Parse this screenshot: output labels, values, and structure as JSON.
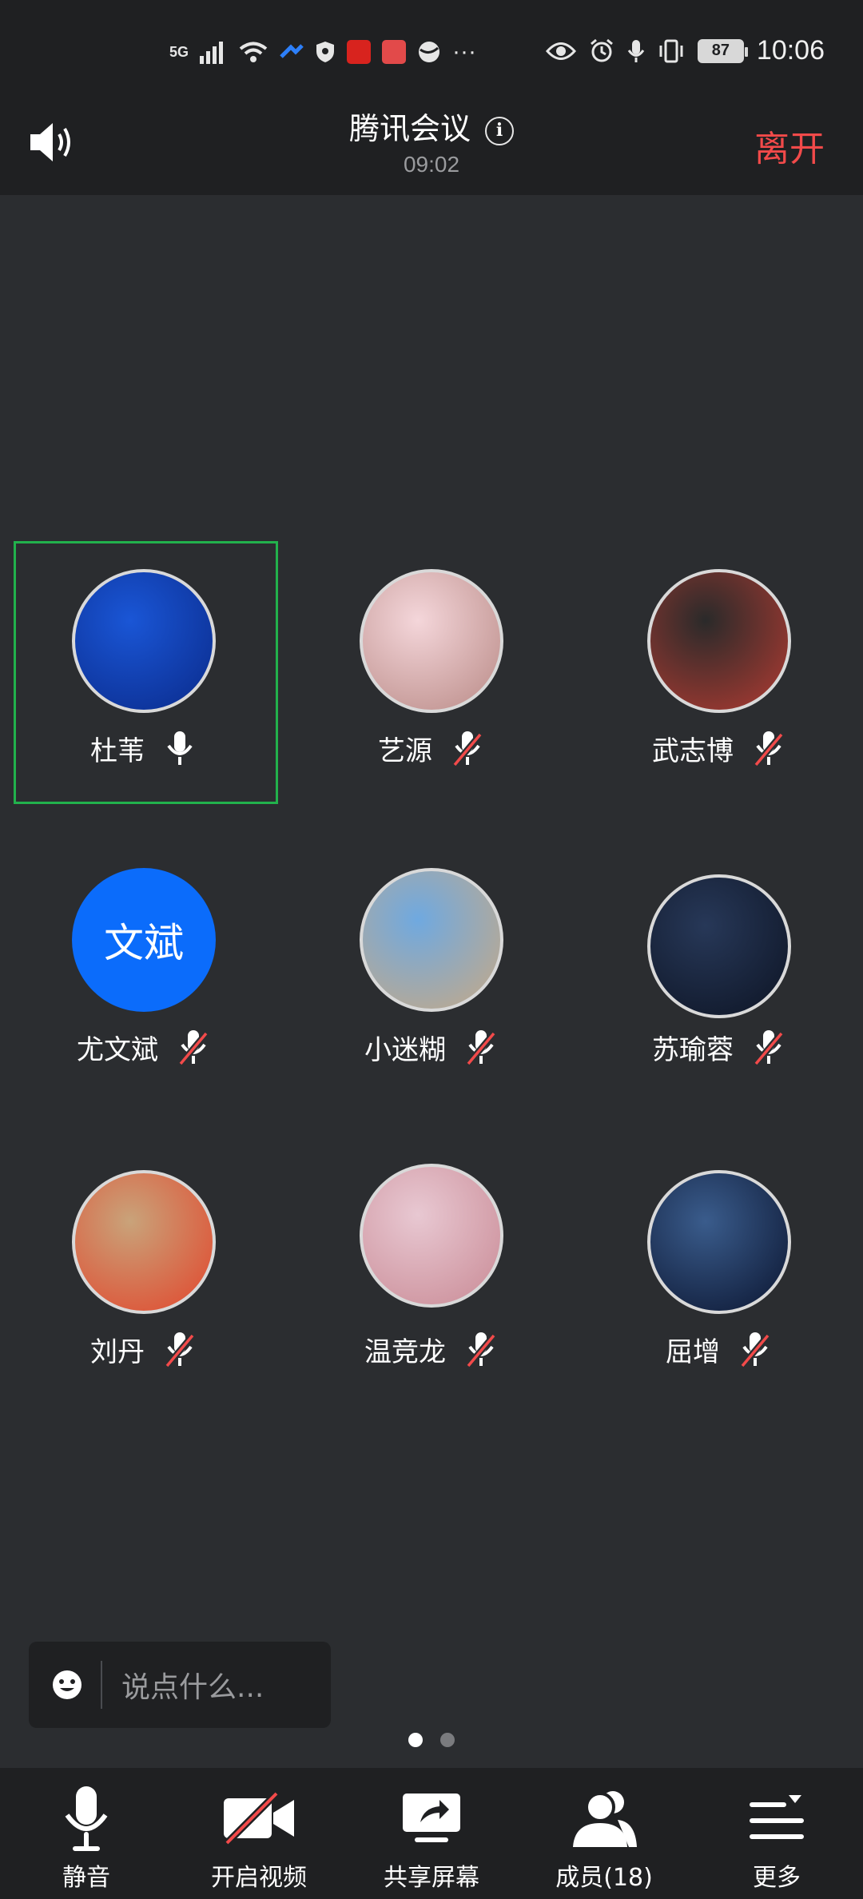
{
  "status_bar": {
    "network": "5G",
    "battery": "87",
    "time": "10:06"
  },
  "header": {
    "title": "腾讯会议",
    "timer": "09:02",
    "leave_label": "离开"
  },
  "participants": [
    {
      "name": "杜苇",
      "muted": false,
      "active": true,
      "avatar_colors": [
        "#1a56d6",
        "#0a2a8a"
      ]
    },
    {
      "name": "艺源",
      "muted": true,
      "active": false,
      "avatar_colors": [
        "#f4d6da",
        "#b98a86"
      ]
    },
    {
      "name": "武志博",
      "muted": true,
      "active": false,
      "avatar_colors": [
        "#2a2a2a",
        "#b23b32"
      ]
    },
    {
      "name": "尤文斌",
      "muted": true,
      "active": false,
      "avatar_text": "文斌"
    },
    {
      "name": "小迷糊",
      "muted": true,
      "active": false,
      "avatar_colors": [
        "#6fa9e0",
        "#c7a985"
      ]
    },
    {
      "name": "苏瑜蓉",
      "muted": true,
      "active": false,
      "avatar_colors": [
        "#273858",
        "#0d1424"
      ]
    },
    {
      "name": "刘丹",
      "muted": true,
      "active": false,
      "avatar_colors": [
        "#c9a37a",
        "#e2452b"
      ]
    },
    {
      "name": "温竞龙",
      "muted": true,
      "active": false,
      "avatar_colors": [
        "#e8c8d2",
        "#c98a95"
      ]
    },
    {
      "name": "屈增",
      "muted": true,
      "active": false,
      "avatar_colors": [
        "#3a5c8c",
        "#0b1530"
      ]
    }
  ],
  "chat": {
    "placeholder": "说点什么..."
  },
  "pages": {
    "count": 2,
    "current": 1
  },
  "toolbar": {
    "mute_label": "静音",
    "video_label": "开启视频",
    "share_label": "共享屏幕",
    "members_label": "成员(18)",
    "more_label": "更多"
  },
  "colors": {
    "accent_leave": "#f24a4a",
    "active_border": "#22b14c",
    "avatar_text_bg": "#0b6cfb",
    "muted_slash": "#f24a4a"
  }
}
